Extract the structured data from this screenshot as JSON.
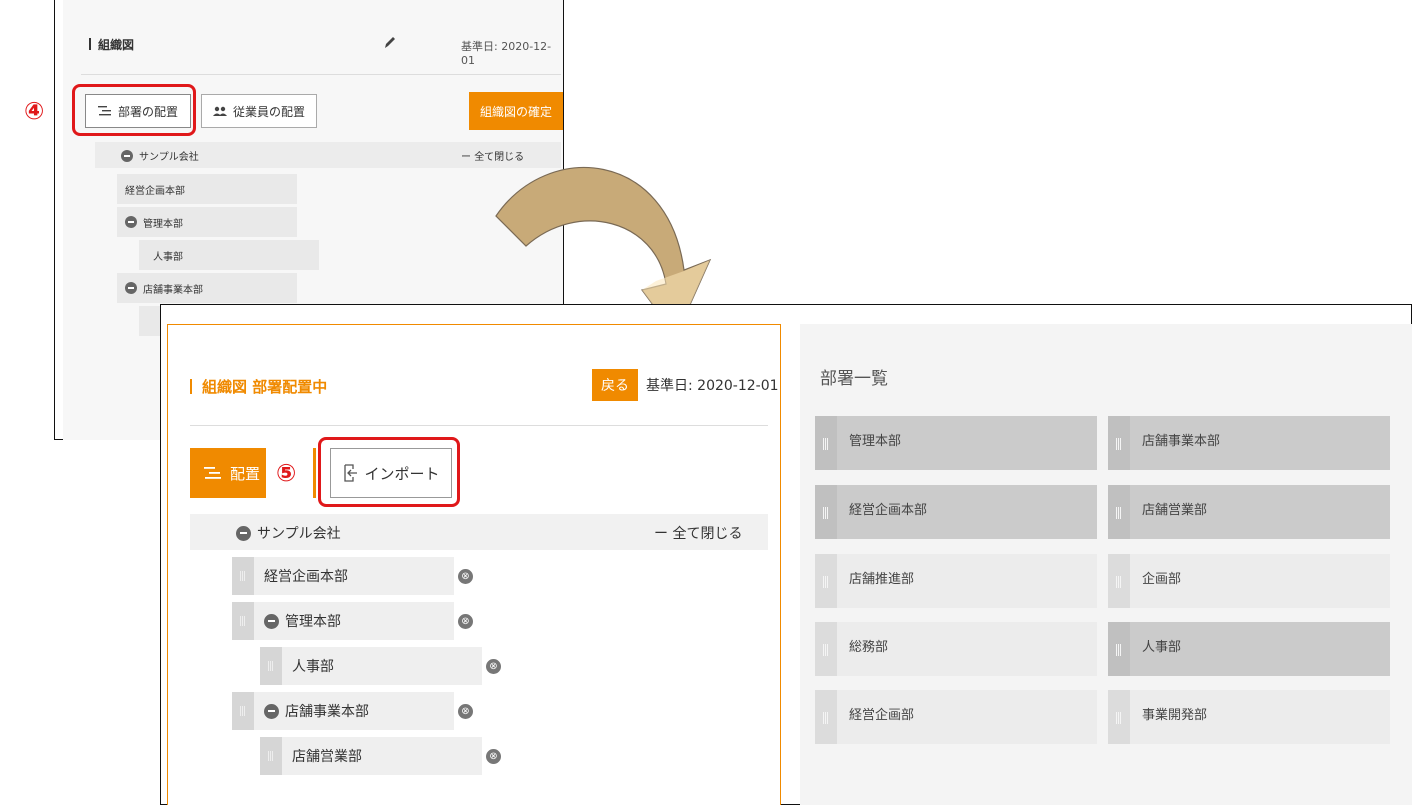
{
  "back_screen": {
    "title": "組織図",
    "date": "基準日: 2020-12-01",
    "tabs": [
      {
        "label": "部署の配置",
        "icon": "tree-icon"
      },
      {
        "label": "従業員の配置",
        "icon": "people-icon"
      }
    ],
    "confirm_label": "組織図の確定",
    "tree": {
      "root": "サンプル会社",
      "collapse_all": "全て閉じる",
      "items": [
        "経営企画本部",
        "管理本部",
        "人事部",
        "店舗事業本部"
      ]
    }
  },
  "callouts": {
    "step4": "④",
    "step5": "⑤"
  },
  "front_screen": {
    "title": "組織図 部署配置中",
    "back_label": "戻る",
    "date": "基準日: 2020-12-01",
    "place_label": "配置",
    "import_label": "インポート",
    "tree": {
      "root": "サンプル会社",
      "collapse_all": "全て閉じる",
      "items": [
        "経営企画本部",
        "管理本部",
        "人事部",
        "店舗事業本部",
        "店舗営業部"
      ]
    },
    "remove_icon": "⊗",
    "department_list": {
      "title": "部署一覧",
      "items": [
        "管理本部",
        "店舗事業本部",
        "経営企画本部",
        "店舗営業部",
        "店舗推進部",
        "企画部",
        "総務部",
        "人事部",
        "経営企画部",
        "事業開発部"
      ]
    }
  },
  "colors": {
    "accent": "#f08a00",
    "callout": "#e0181a",
    "arrow": "#c8aa78"
  }
}
